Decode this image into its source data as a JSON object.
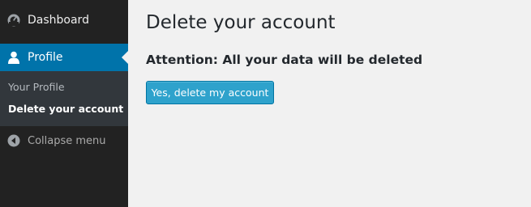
{
  "sidebar": {
    "items": [
      {
        "label": "Dashboard",
        "icon": "dashboard-icon"
      },
      {
        "label": "Profile",
        "icon": "user-icon",
        "active": true
      }
    ],
    "submenu": [
      {
        "label": "Your Profile"
      },
      {
        "label": "Delete your account",
        "current": true
      }
    ],
    "collapse": {
      "label": "Collapse menu",
      "icon": "collapse-arrow-icon"
    }
  },
  "main": {
    "title": "Delete your account",
    "warning": "Attention: All your data will be deleted",
    "delete_button": "Yes, delete my account"
  },
  "colors": {
    "sidebar_bg": "#222222",
    "submenu_bg": "#32373c",
    "active_bg": "#0073aa",
    "page_bg": "#f1f1f1",
    "button_bg": "#2ea2cc"
  }
}
